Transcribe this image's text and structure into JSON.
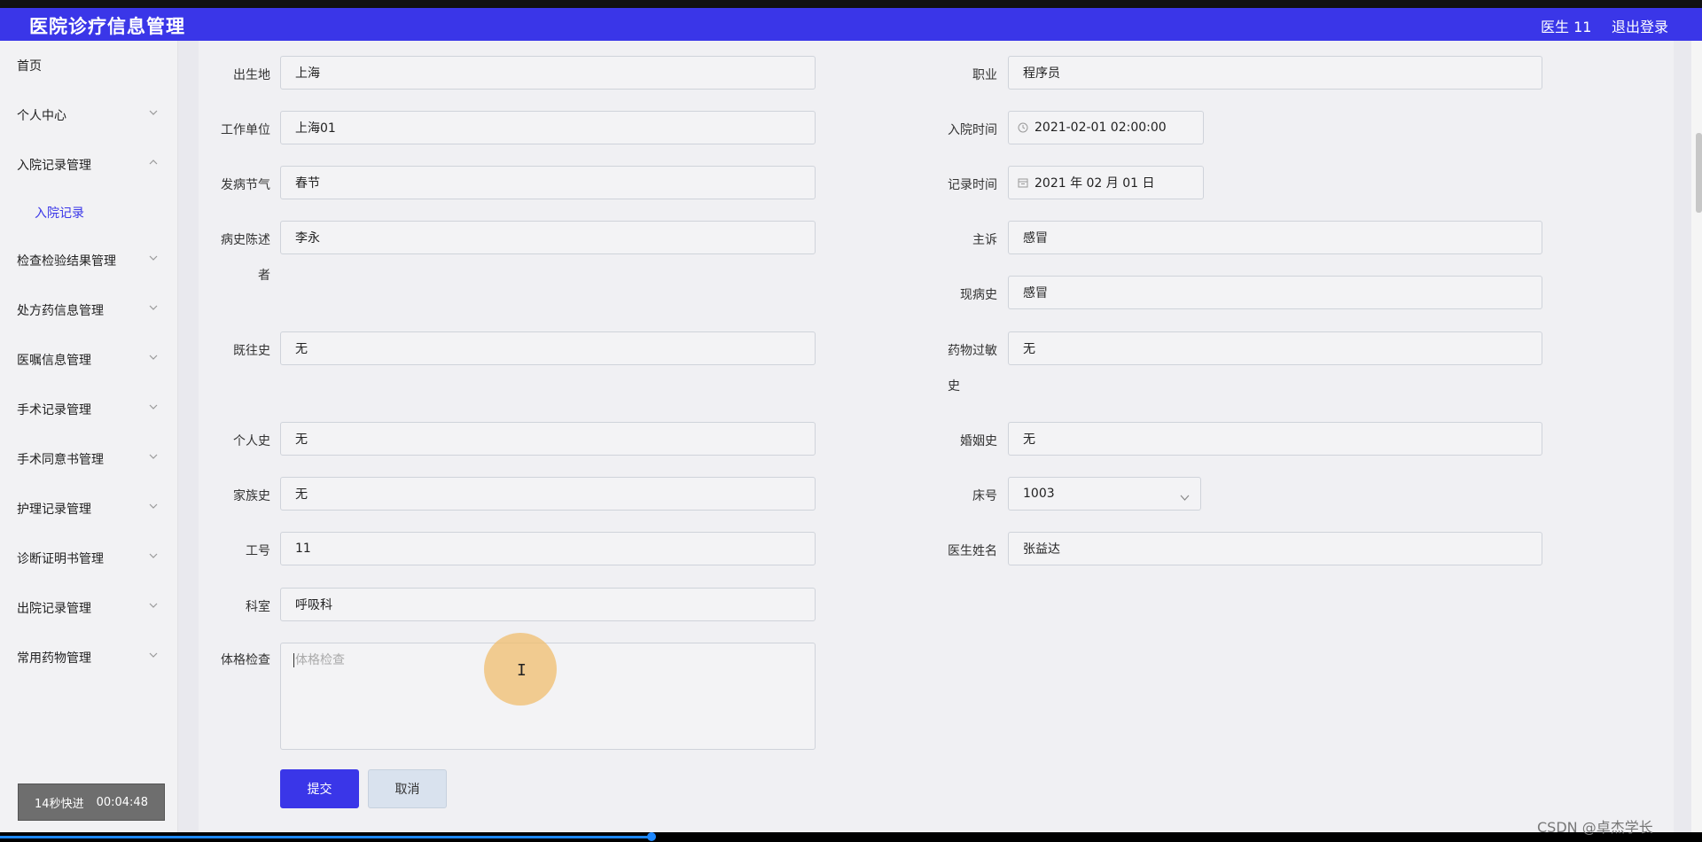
{
  "header": {
    "title": "医院诊疗信息管理",
    "user": "医生 11",
    "logout": "退出登录"
  },
  "sidebar": {
    "items": [
      {
        "label": "首页",
        "has_arrow": false
      },
      {
        "label": "个人中心",
        "has_arrow": true
      },
      {
        "label": "入院记录管理",
        "has_arrow": true,
        "expanded": true
      },
      {
        "label": "检查检验结果管理",
        "has_arrow": true
      },
      {
        "label": "处方药信息管理",
        "has_arrow": true
      },
      {
        "label": "医嘱信息管理",
        "has_arrow": true
      },
      {
        "label": "手术记录管理",
        "has_arrow": true
      },
      {
        "label": "手术同意书管理",
        "has_arrow": true
      },
      {
        "label": "护理记录管理",
        "has_arrow": true
      },
      {
        "label": "诊断证明书管理",
        "has_arrow": true
      },
      {
        "label": "出院记录管理",
        "has_arrow": true
      },
      {
        "label": "常用药物管理",
        "has_arrow": true
      }
    ],
    "subitem": "入院记录"
  },
  "timer": {
    "speed": "14秒快进",
    "time": "00:04:48"
  },
  "form": {
    "birthplace": {
      "label": "出生地",
      "value": "上海"
    },
    "occupation": {
      "label": "职业",
      "value": "程序员"
    },
    "employer": {
      "label": "工作单位",
      "value": "上海01"
    },
    "admission_time": {
      "label": "入院时间",
      "value": "2021-02-01 02:00:00",
      "icon": "clock-icon"
    },
    "onset_season": {
      "label": "发病节气",
      "value": "春节"
    },
    "record_time": {
      "label": "记录时间",
      "value": "2021 年 02 月 01 日",
      "icon": "calendar-icon"
    },
    "history_narrator": {
      "label_line1": "病史陈述",
      "label_line2": "者",
      "value": "李永"
    },
    "chief_complaint": {
      "label": "主诉",
      "value": "感冒"
    },
    "present_illness": {
      "label": "现病史",
      "value": "感冒"
    },
    "past_history": {
      "label": "既往史",
      "value": "无"
    },
    "drug_allergy": {
      "label_line1": "药物过敏",
      "label_line2": "史",
      "value": "无"
    },
    "personal_history": {
      "label": "个人史",
      "value": "无"
    },
    "marital_history": {
      "label": "婚姻史",
      "value": "无"
    },
    "family_history": {
      "label": "家族史",
      "value": "无"
    },
    "bed_number": {
      "label": "床号",
      "value": "1003"
    },
    "employee_id": {
      "label": "工号",
      "value": "11"
    },
    "doctor_name": {
      "label": "医生姓名",
      "value": "张益达"
    },
    "department": {
      "label": "科室",
      "value": "呼吸科"
    },
    "physical_exam": {
      "label": "体格检查",
      "placeholder": "体格检查"
    },
    "submit": "提交",
    "cancel": "取消"
  },
  "watermark": "CSDN @卓杰学长",
  "colors": {
    "accent": "#3a36e8",
    "progress": "#1e88ff"
  }
}
